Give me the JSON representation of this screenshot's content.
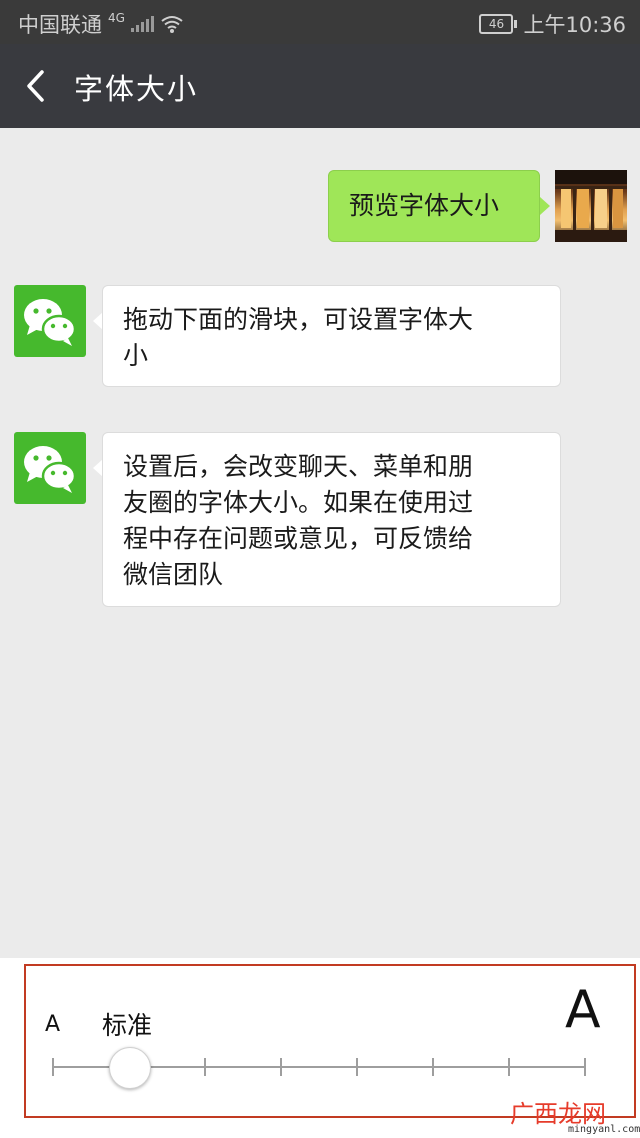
{
  "status_bar": {
    "carrier": "中国联通",
    "network": "4G",
    "battery": "46",
    "time": "上午10:36"
  },
  "header": {
    "title": "字体大小",
    "back_icon": "chevron-left-icon"
  },
  "messages": [
    {
      "side": "right",
      "text": "预览字体大小",
      "avatar": "user-photo"
    },
    {
      "side": "left",
      "line1": "拖动下面的滑块，可设置字体大",
      "line2": "小",
      "avatar": "wechat-logo"
    },
    {
      "side": "left",
      "line1": "设置后，会改变聊天、菜单和朋",
      "line2": "友圈的字体大小。如果在使用过",
      "line3": "程中存在问题或意见，可反馈给",
      "line4": "微信团队",
      "avatar": "wechat-logo"
    }
  ],
  "font_slider": {
    "small_label": "A",
    "large_label": "A",
    "current_label": "标准",
    "positions": 8,
    "selected_index": 1
  },
  "watermark": {
    "text": "广西龙网",
    "domain": "mingyanl.com"
  },
  "colors": {
    "titlebar": "#393a3f",
    "sent_bubble": "#9fe658",
    "wechat_green": "#46b92d",
    "frame": "#c23b22"
  }
}
